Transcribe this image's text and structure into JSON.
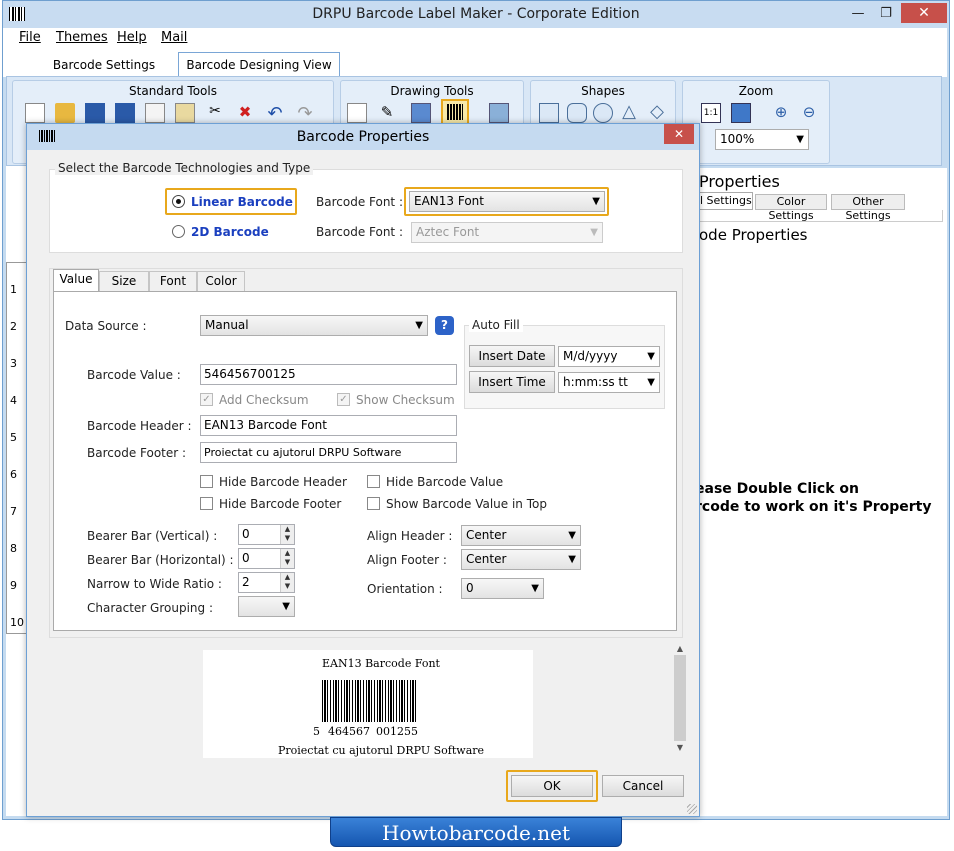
{
  "app": {
    "title": "DRPU Barcode Label Maker - Corporate Edition",
    "min": "—",
    "max": "❐",
    "close": "✕"
  },
  "menu": [
    "File",
    "Themes",
    "Help",
    "Mail"
  ],
  "app_tabs": [
    "Barcode Settings",
    "Barcode Designing View"
  ],
  "ribbon": {
    "standard_tools": "Standard Tools",
    "drawing_tools": "Drawing Tools",
    "shapes": "Shapes",
    "zoom": "Zoom",
    "zoom_value": "100%",
    "zoom_1to1": "1:1"
  },
  "ruler": [
    "1",
    "2",
    "3",
    "4",
    "5",
    "6",
    "7",
    "8",
    "9",
    "10"
  ],
  "right_panel": {
    "title": "Properties",
    "tabs": [
      "l Settings",
      "Color Settings",
      "Other Settings"
    ],
    "subtitle": "ode Properties",
    "hint_line1": "ease Double Click on",
    "hint_line2": "rcode to work on it's Property"
  },
  "dialog": {
    "title": "Barcode Properties",
    "close": "✕",
    "group_title": "Select the Barcode Technologies and Type",
    "linear_label": "Linear Barcode",
    "twod_label": "2D Barcode",
    "font_label1": "Barcode Font :",
    "font_label2": "Barcode Font :",
    "font_value1": "EAN13 Font",
    "font_value2": "Aztec Font",
    "tabs": [
      "Value",
      "Size",
      "Font",
      "Color"
    ],
    "data_source_label": "Data Source :",
    "data_source_value": "Manual",
    "help": "?",
    "autofill_title": "Auto Fill",
    "insert_date": "Insert Date",
    "insert_time": "Insert Time",
    "date_format": "M/d/yyyy",
    "time_format": "h:mm:ss tt",
    "value_label": "Barcode Value :",
    "value": "546456700125",
    "add_checksum": "Add Checksum",
    "show_checksum": "Show Checksum",
    "header_label": "Barcode Header :",
    "header_value": "EAN13 Barcode Font",
    "footer_label": "Barcode Footer :",
    "footer_value": "Proiectat cu ajutorul DRPU Software",
    "hide_header": "Hide Barcode Header",
    "hide_footer": "Hide Barcode Footer",
    "hide_value": "Hide Barcode Value",
    "show_value_top": "Show Barcode Value in Top",
    "bearer_v_label": "Bearer Bar (Vertical) :",
    "bearer_h_label": "Bearer Bar (Horizontal) :",
    "ratio_label": "Narrow to Wide Ratio :",
    "grouping_label": "Character Grouping :",
    "bearer_v": "0",
    "bearer_h": "0",
    "ratio": "2",
    "align_header_label": "Align Header :",
    "align_footer_label": "Align Footer :",
    "orientation_label": "Orientation :",
    "align_header": "Center",
    "align_footer": "Center",
    "orientation": "0",
    "preview_header": "EAN13 Barcode Font",
    "preview_digits": [
      "5",
      "464567",
      "001255"
    ],
    "preview_footer": "Proiectat cu ajutorul DRPU Software",
    "ok": "OK",
    "cancel": "Cancel"
  },
  "footer_brand": "Howtobarcode.net",
  "colors": {
    "accent_highlight": "#e8a81c",
    "link_blue": "#1a3fbf",
    "footer_blue": "#1f63c2"
  }
}
